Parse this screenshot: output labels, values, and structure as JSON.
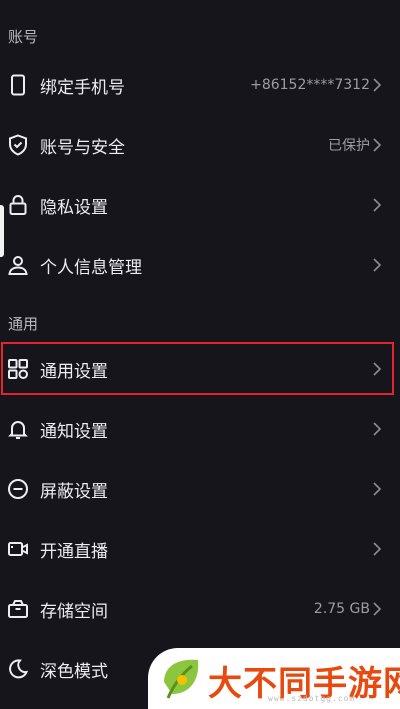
{
  "sections": {
    "account_header": "账号",
    "general_header": "通用"
  },
  "rows": [
    {
      "icon": "phone-icon",
      "label": "绑定手机号",
      "value": "+86152****7312"
    },
    {
      "icon": "shield-check-icon",
      "label": "账号与安全",
      "value": "已保护"
    },
    {
      "icon": "lock-icon",
      "label": "隐私设置",
      "value": ""
    },
    {
      "icon": "person-icon",
      "label": "个人信息管理",
      "value": ""
    },
    {
      "icon": "grid-icon",
      "label": "通用设置",
      "value": ""
    },
    {
      "icon": "bell-icon",
      "label": "通知设置",
      "value": ""
    },
    {
      "icon": "block-icon",
      "label": "屏蔽设置",
      "value": ""
    },
    {
      "icon": "video-camera-icon",
      "label": "开通直播",
      "value": ""
    },
    {
      "icon": "storage-icon",
      "label": "存储空间",
      "value": "2.75 GB"
    },
    {
      "icon": "moon-icon",
      "label": "深色模式",
      "value": ""
    }
  ],
  "watermark": {
    "text": "大不同手游网",
    "url": "www.szdbtgg.com"
  },
  "colors": {
    "background": "#16151b",
    "highlight": "#e2242e",
    "watermark_text": "#e8490f"
  }
}
